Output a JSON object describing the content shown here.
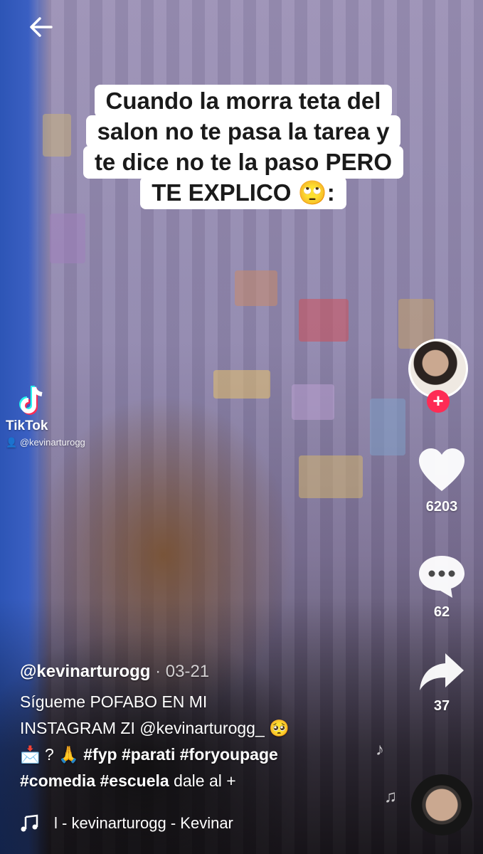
{
  "caption": {
    "lines": [
      "Cuando la morra teta del",
      "salon no te pasa la tarea y",
      "te dice no te la paso PERO",
      "TE EXPLICO 🙄:"
    ]
  },
  "watermark": {
    "brand": "TikTok",
    "user": "@kevinarturogg"
  },
  "actions": {
    "likes": "6203",
    "comments": "62",
    "shares": "37"
  },
  "post": {
    "username": "@kevinarturogg",
    "date": "· 03-21",
    "description_lines": [
      "Sígueme POFABO EN MI",
      "INSTAGRAM ZI @kevinarturogg_ 🥺",
      "📩 ? 🙏"
    ],
    "hashtags_line3": [
      "#fyp",
      "#parati",
      "#foryoupage"
    ],
    "hashtags_line4": [
      "#comedia",
      "#escuela"
    ],
    "line4_suffix": "dale al +"
  },
  "music": {
    "text": "l - kevinarturogg - Kevinar"
  },
  "icons": {
    "back": "back-arrow-icon",
    "like": "heart-icon",
    "comment": "comment-bubble-icon",
    "share": "share-arrow-icon",
    "music": "music-note-icon",
    "follow": "plus-icon"
  },
  "colors": {
    "follow": "#fe2c55",
    "caption_bg": "#ffffff",
    "text": "#ffffff"
  }
}
